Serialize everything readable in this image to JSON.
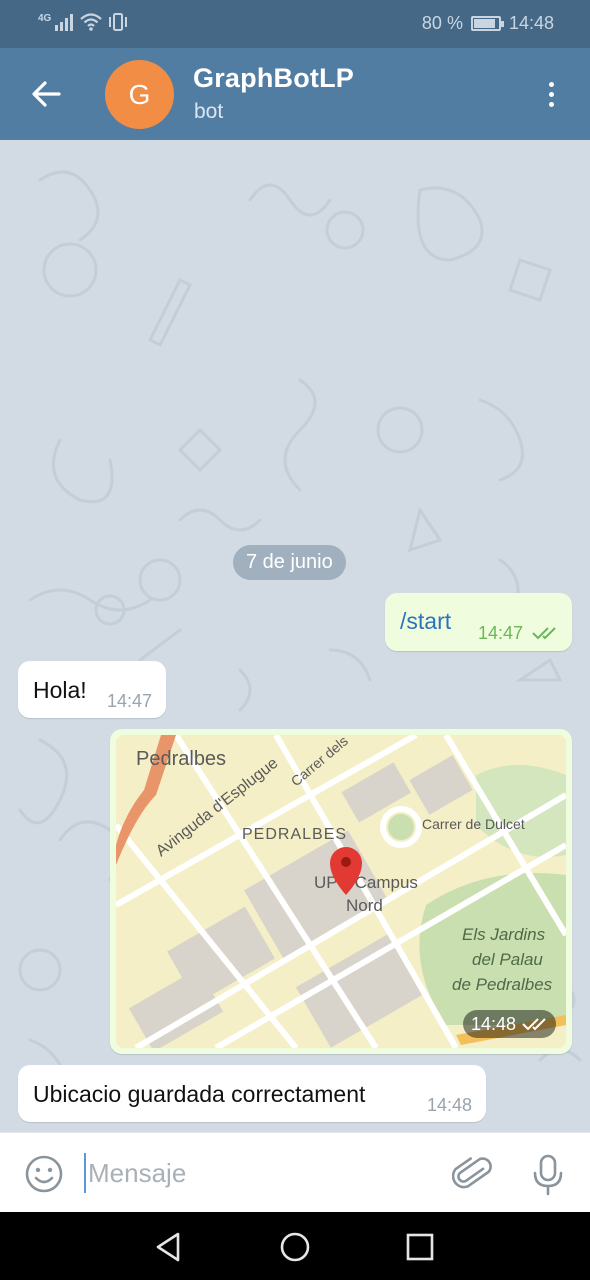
{
  "status_bar": {
    "network": "4G",
    "battery_text": "80 %",
    "battery_level": 0.8,
    "time": "14:48",
    "icons": [
      "signal-icon",
      "wifi-icon",
      "vibrate-icon",
      "battery-icon"
    ]
  },
  "header": {
    "back_icon": "arrow-left-icon",
    "avatar_letter": "G",
    "avatar_color": "#f18d45",
    "title": "GraphBotLP",
    "subtitle": "bot",
    "menu_icon": "more-vertical-icon",
    "bar_color": "#527da3"
  },
  "chat": {
    "date_label": "7 de junio",
    "messages": [
      {
        "direction": "outgoing",
        "text": "/start",
        "time": "14:47",
        "status": "read"
      },
      {
        "direction": "incoming",
        "text": "Hola!",
        "time": "14:47"
      },
      {
        "direction": "outgoing",
        "type": "location",
        "time": "14:48",
        "status": "read",
        "map_labels": [
          "Pedralbes",
          "Avinguda d'Esplugue",
          "Carrer dels",
          "PEDRALBES",
          "Carrer de Dulcet",
          "UPC Campus",
          "Nord",
          "Els Jardins",
          "del Palau",
          "de Pedralbes"
        ]
      },
      {
        "direction": "incoming",
        "text": "Ubicacio guardada correctament",
        "time": "14:48"
      }
    ]
  },
  "input_bar": {
    "placeholder": "Mensaje",
    "value": "",
    "icons": [
      "emoji-icon",
      "paperclip-icon",
      "microphone-icon"
    ]
  },
  "nav_bar": {
    "icons": [
      "nav-back-icon",
      "nav-home-icon",
      "nav-recents-icon"
    ]
  }
}
